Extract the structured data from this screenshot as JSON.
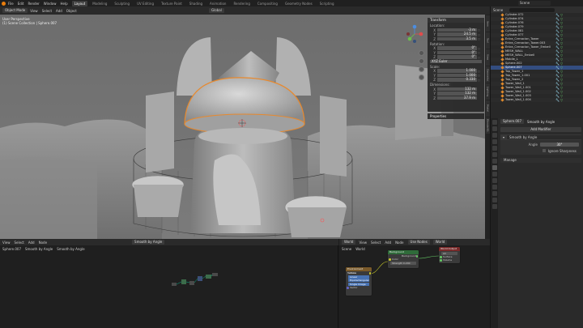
{
  "topbar": {
    "menus": [
      "File",
      "Edit",
      "Render",
      "Window",
      "Help"
    ],
    "workspaces": [
      "Layout",
      "Modeling",
      "Sculpting",
      "UV Editing",
      "Texture Paint",
      "Shading",
      "Animation",
      "Rendering",
      "Compositing",
      "Geometry Nodes",
      "Scripting"
    ],
    "active_workspace": "Layout",
    "scene": "Scene"
  },
  "viewport_header": {
    "mode": "Object Mode",
    "menus": [
      "View",
      "Select",
      "Add",
      "Object"
    ],
    "orientation": "Global"
  },
  "viewport": {
    "info_line1": "User Perspective",
    "info_line2": "(1) Scene Collection | Sphere.007"
  },
  "npanel": {
    "header": "Transform",
    "location_label": "Location:",
    "location": [
      [
        "X",
        "-3 m"
      ],
      [
        "Y",
        "24.5 m"
      ],
      [
        "Z",
        "3.5 m"
      ]
    ],
    "rotation_label": "Rotation:",
    "rotation": [
      [
        "X",
        "0°"
      ],
      [
        "Y",
        "0°"
      ],
      [
        "Z",
        "0°"
      ]
    ],
    "mode": "XYZ Euler",
    "scale_label": "Scale:",
    "scale": [
      [
        "X",
        "1.000"
      ],
      [
        "Y",
        "1.000"
      ],
      [
        "Z",
        "0.330"
      ]
    ],
    "dimensions_label": "Dimensions:",
    "dimensions": [
      [
        "X",
        "132 m"
      ],
      [
        "Y",
        "132 m"
      ],
      [
        "Z",
        "37.9 m"
      ]
    ],
    "properties_header": "Properties"
  },
  "side_tabs": [
    "Item",
    "Tool",
    "View",
    "Geometry",
    "Lighting",
    "Model",
    "BlenderKit"
  ],
  "outliner": {
    "title": "Scene",
    "items": [
      "Cylinder.072",
      "Cylinder.074",
      "Cylinder.076",
      "Cylinder.079",
      "Cylinder.081",
      "Cylinder.077",
      "Entra_Crenacion_Tower",
      "Entra_Crenacion_Tower.003",
      "Entra_Crenacion_Tower_Embell",
      "MESH_WALL",
      "MESH_WALL_Embell",
      "Mobile_L",
      "Sphere.002",
      "Sphere.007",
      "Top_Tower_1",
      "Top_Tower_1.001",
      "Top_Tower_2",
      "Tower_Wall_1",
      "Tower_Wall_1.001",
      "Tower_Wall_1.002",
      "Tower_Wall_1.003",
      "Tower_Wall_1.004"
    ],
    "selected_index": 13
  },
  "properties": {
    "object_name": "Sphere.007",
    "modifier_title": "Smooth by Angle",
    "add_modifier": "Add Modifier",
    "modifier_name": "Smooth by Angle",
    "angle_label": "Angle",
    "angle_value": "30°",
    "ignore_sharp": "Ignore Sharpness",
    "manage_label": "Manage"
  },
  "left_node_editor": {
    "menus": [
      "View",
      "Select",
      "Add",
      "Node"
    ],
    "modifier": "Smooth by Angle",
    "crumbs": [
      "Sphere.007",
      "Smooth by Angle",
      "Smooth by Angle"
    ]
  },
  "right_node_editor": {
    "type": "World",
    "menus": [
      "View",
      "Select",
      "Add",
      "Node"
    ],
    "use_nodes": "Use Nodes",
    "slot": "World",
    "crumbs": [
      "Scene",
      "World"
    ],
    "nodes": {
      "bg_title": "Background",
      "bg_rows": [
        "Background",
        "Color",
        "Strength 0.200"
      ],
      "out_title": "World Output",
      "out_rows": [
        "All",
        "Surface",
        "Volume"
      ],
      "tex_title": "Environment Texture",
      "tex_rows": [
        "Color",
        "Linear",
        "Equirectangular",
        "Single Image",
        "Vector"
      ]
    }
  }
}
